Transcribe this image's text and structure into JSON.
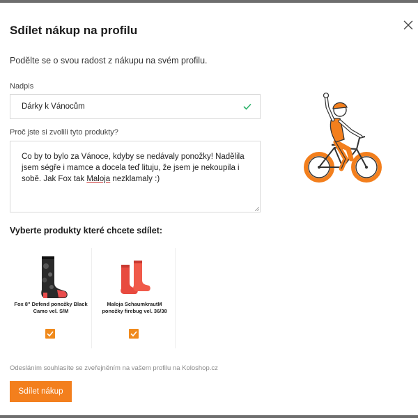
{
  "dialog": {
    "title": "Sdílet nákup na profilu",
    "subtitle": "Podělte se o svou radost z nákupu na svém profilu.",
    "close_icon": "close-icon"
  },
  "form": {
    "heading_label": "Nadpis",
    "heading_value": "Dárky k Vánocům",
    "heading_valid_icon": "check-icon",
    "reason_label": "Proč jste si zvolili tyto produkty?",
    "reason_text_part1": "Co by to bylo za Vánoce, kdyby se nedávaly ponožky! Nadělila jsem ségře i mamce a docela teď lituju, že jsem je nekoupila i sobě. Jak Fox tak ",
    "reason_text_misspelled": "Maloja",
    "reason_text_part2": " nezklamaly :)"
  },
  "products": {
    "heading": "Vyberte produkty které chcete sdílet:",
    "items": [
      {
        "name": "Fox 8\" Defend ponožky Black Camo vel. S/M",
        "checked": true,
        "image": "black-camo-sock"
      },
      {
        "name": "Maloja SchaumkrautM ponožky firebug vel. 36/38",
        "checked": true,
        "image": "red-sock"
      }
    ]
  },
  "footer": {
    "consent_text": "Odesláním souhlasíte se zveřejněním na vašem profilu na Koloshop.cz",
    "share_button": "Sdílet nákup"
  },
  "colors": {
    "accent": "#f37f1d",
    "valid_check": "#2db36b",
    "text": "#222222"
  }
}
